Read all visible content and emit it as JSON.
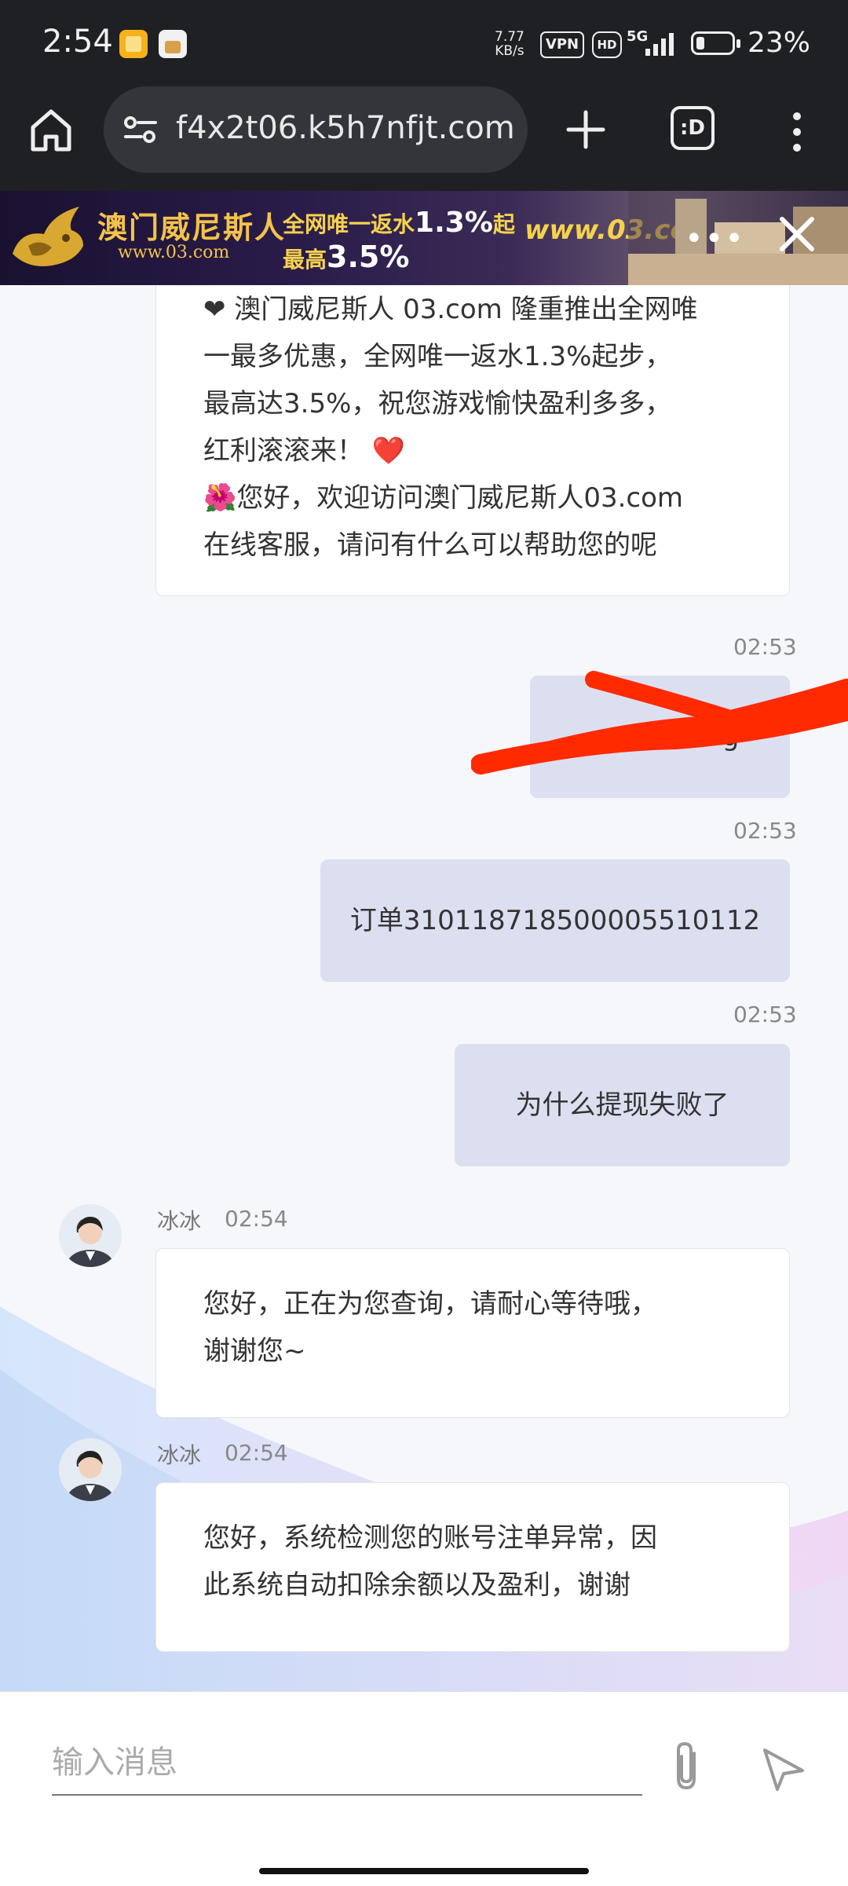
{
  "status_bar": {
    "time": "2:54",
    "net_speed_value": "7.77",
    "net_speed_unit": "KB/s",
    "vpn": "VPN",
    "hd": "HD",
    "signal": "5G",
    "battery_percent": "23%",
    "battery_level": 0.23
  },
  "browser": {
    "url": "f4x2t06.k5h7nfjt.com",
    "tab_count": ":D"
  },
  "banner": {
    "brand": "澳门威尼斯人",
    "brand_url": "www.03.com",
    "line1_prefix": "全网唯一返水",
    "line1_value": "1.3%",
    "line1_suffix": "起",
    "line2_prefix": "最高",
    "line2_value": "3.5%",
    "url_right": "www.03.co",
    "more": "•••"
  },
  "chat": {
    "messages": [
      {
        "side": "left",
        "lines": [
          "❤ 澳门威尼斯人 03.com 隆重推出全网唯",
          "一最多优惠，全网唯一返水1.3%起步，",
          "最高达3.5%，祝您游戏愉快盈利多多，",
          "红利滚滚来！",
          "🌺您好，欢迎访问澳门威尼斯人03.com",
          "在线客服，请问有什么可以帮助您的呢"
        ],
        "heart": "❤️"
      },
      {
        "side": "right",
        "time": "02:53",
        "text": "g"
      },
      {
        "side": "right",
        "time": "02:53",
        "text": "订单310118718500005510112"
      },
      {
        "side": "right",
        "time": "02:53",
        "text": "为什么提现失败了"
      },
      {
        "side": "left",
        "sender": "冰冰",
        "time": "02:54",
        "lines": [
          "您好，正在为您查询，请耐心等待哦，",
          "谢谢您~"
        ]
      },
      {
        "side": "left",
        "sender": "冰冰",
        "time": "02:54",
        "lines": [
          "您好，系统检测您的账号注单异常，因",
          "此系统自动扣除余额以及盈利，谢谢"
        ]
      }
    ]
  },
  "input": {
    "placeholder": "输入消息"
  },
  "colors": {
    "bubble_right": "#dcdff0",
    "bubble_left": "#ffffff",
    "status_bar_bg": "#1f2024",
    "scribble": "#ff2a00"
  }
}
